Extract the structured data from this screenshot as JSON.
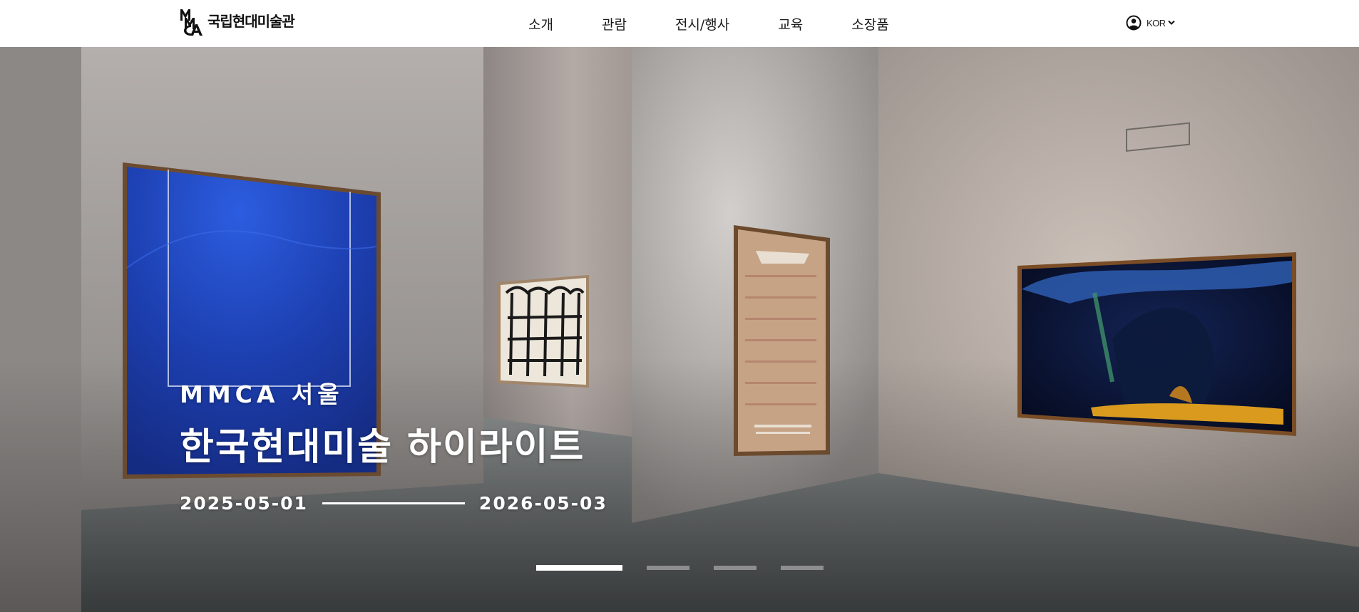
{
  "header": {
    "logo_text": "국립현대미술관",
    "logo_mark_letters": "MMCA",
    "nav": [
      {
        "label": "소개"
      },
      {
        "label": "관람"
      },
      {
        "label": "전시/행사"
      },
      {
        "label": "교육"
      },
      {
        "label": "소장품"
      }
    ],
    "utility": {
      "account_icon": "user-circle-icon",
      "language": "KOR",
      "language_icon": "chevron-down-icon"
    }
  },
  "hero": {
    "venue": "MMCA 서울",
    "title": "한국현대미술 하이라이트",
    "start_date": "2025-05-01",
    "end_date": "2026-05-03",
    "slide_count": 4,
    "active_slide": 1
  },
  "colors": {
    "header_bg": "#ffffff",
    "text_dark": "#111111",
    "hero_text": "#ffffff",
    "pager_active": "#ffffff",
    "pager_inactive": "#969696"
  }
}
